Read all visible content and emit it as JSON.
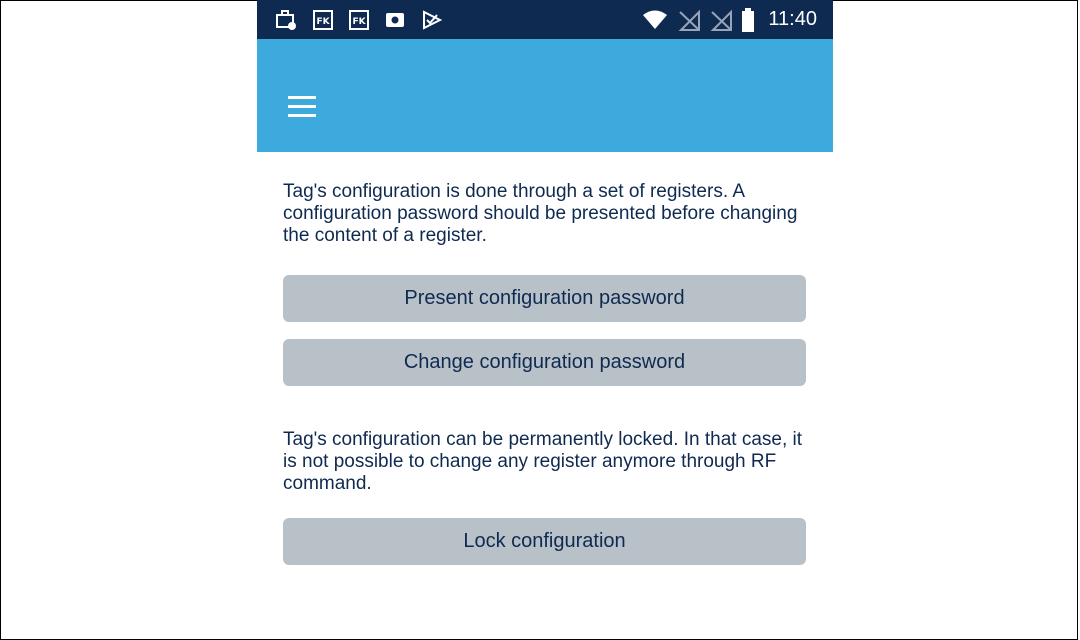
{
  "status_bar": {
    "time": "11:40",
    "left_icons": [
      "briefcase-icon",
      "fk-app-icon",
      "fk-app-icon",
      "media-icon",
      "check-app-icon"
    ],
    "right_icons": [
      "wifi-icon",
      "no-sim-icon",
      "no-sim-icon",
      "battery-icon"
    ]
  },
  "app_bar": {
    "menu_icon": "hamburger-menu-icon",
    "color": "#3caadc"
  },
  "config": {
    "intro_text": "Tag's configuration is done through a set of registers. A configuration password should be presented before changing the content of a register.",
    "present_password_label": "Present configuration password",
    "change_password_label": "Change configuration password",
    "lock_text": "Tag's configuration can be permanently locked. In that case, it is not possible to change any register anymore through RF command.",
    "lock_label": "Lock configuration"
  },
  "colors": {
    "status_bar": "#0f2a50",
    "button_bg": "#b9c1c8",
    "text": "#0f2a50"
  }
}
